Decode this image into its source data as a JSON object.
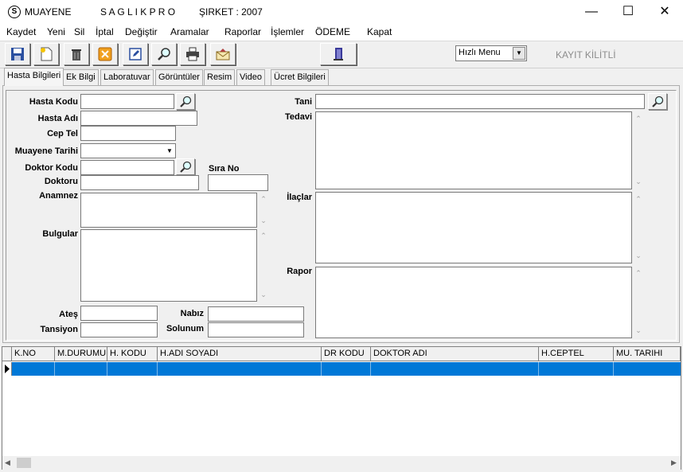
{
  "window": {
    "title": "MUAYENE",
    "app_name": "S A G L I K P R O",
    "company": "ŞIRKET : 2007",
    "icon": "saglikpro-logo-icon"
  },
  "menu": [
    "Kaydet",
    "Yeni",
    "Sil",
    "İptal",
    "Değiştir",
    "Aramalar",
    "Raporlar",
    "İşlemler",
    "ÖDEME",
    "Kapat"
  ],
  "toolbar": {
    "buttons": [
      "save-icon",
      "new-document-icon",
      "trash-icon",
      "cancel-icon",
      "edit-icon",
      "search-icon",
      "print-icon",
      "mail-icon",
      "exit-door-icon"
    ],
    "quick_menu": "Hızlı Menu",
    "lock_status": "KAYIT KİLİTLİ"
  },
  "tabs": [
    "Hasta Bilgileri",
    "Ek Bilgi",
    "Laboratuvar",
    "Görüntüler",
    "Resim",
    "Video",
    "Ücret Bilgileri"
  ],
  "form": {
    "hasta_kodu": "Hasta Kodu",
    "hasta_adi": "Hasta Adı",
    "cep_tel": "Cep Tel",
    "muayene_tarihi": "Muayene Tarihi",
    "doktor_kodu": "Doktor Kodu",
    "sira_no": "Sıra No",
    "doktoru": "Doktoru",
    "anamnez": "Anamnez",
    "bulgular": "Bulgular",
    "ates": "Ateş",
    "nabiz": "Nabız",
    "tansiyon": "Tansiyon",
    "solunum": "Solunum",
    "tani": "Tani",
    "tedavi": "Tedavi",
    "ilaclar": "İlaçlar",
    "rapor": "Rapor"
  },
  "grid": {
    "columns": [
      "K.NO",
      "M.DURUMU",
      "H. KODU",
      "H.ADI SOYADI",
      "DR KODU",
      "DOKTOR ADI",
      "H.CEPTEL",
      "MU. TARIHI"
    ]
  },
  "colors": {
    "selection": "#0078d7",
    "lock_text": "#8c8c8c"
  }
}
